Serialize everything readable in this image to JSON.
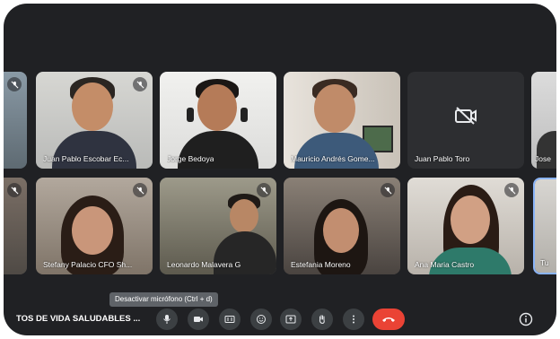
{
  "participants": [
    {
      "name": "Juan Pablo Escobar Ec...",
      "muted": true
    },
    {
      "name": "Jorge Bedoya",
      "muted": false
    },
    {
      "name": "Mauricio Andrés Gome...",
      "muted": false
    },
    {
      "name": "Juan Pablo Toro",
      "muted": false,
      "camera_off": true
    },
    {
      "name": "Jose",
      "muted": false
    },
    {
      "name": "Stefany Palacio CFO Sh...",
      "muted": true
    },
    {
      "name": "Leonardo Malavera G",
      "muted": true
    },
    {
      "name": "Estefania Moreno",
      "muted": true
    },
    {
      "name": "Ana Maria Castro",
      "muted": true
    },
    {
      "name": "Tu",
      "muted": false
    }
  ],
  "meeting_title": "TOS DE VIDA SALUDABLES ...",
  "tooltip": "Desactivar micrófono (Ctrl + d)",
  "controls": {
    "mic": "mic-icon",
    "camera": "camera-icon",
    "captions": "captions-icon",
    "emoji": "emoji-icon",
    "present": "present-icon",
    "hand": "raise-hand-icon",
    "more": "more-icon",
    "hangup": "hangup-icon",
    "info": "info-icon"
  },
  "colors": {
    "background": "#202124",
    "tile": "#3c4043",
    "hangup": "#ea4335",
    "self_border": "#8ab4f8"
  }
}
